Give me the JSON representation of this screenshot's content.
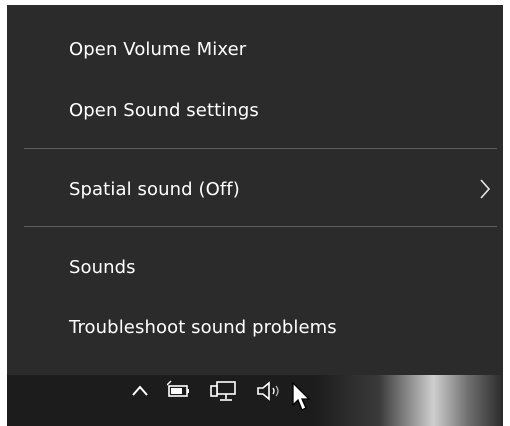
{
  "menu": {
    "items": [
      {
        "label": "Open Volume Mixer"
      },
      {
        "label": "Open Sound settings"
      },
      {
        "label": "Spatial sound (Off)",
        "submenu_icon": "chevron-right-icon"
      },
      {
        "label": "Sounds"
      },
      {
        "label": "Troubleshoot sound problems"
      }
    ]
  },
  "taskbar": {
    "tray_icons": [
      "chevron-up-icon",
      "battery-icon",
      "network-icon",
      "speaker-icon"
    ],
    "pointer": "mouse-cursor-icon"
  },
  "colors": {
    "menu_background": "#2b2b2b",
    "menu_text": "#ffffff",
    "separator": "#5e5e5e",
    "taskbar": "#1c1c1c"
  }
}
